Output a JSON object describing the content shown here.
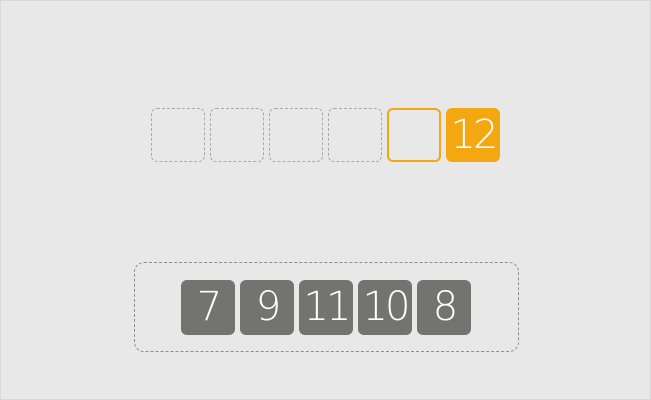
{
  "answer_row": {
    "slots": [
      {
        "state": "empty",
        "value": ""
      },
      {
        "state": "empty",
        "value": ""
      },
      {
        "state": "empty",
        "value": ""
      },
      {
        "state": "empty",
        "value": ""
      },
      {
        "state": "target",
        "value": ""
      },
      {
        "state": "filled",
        "value": "12"
      }
    ]
  },
  "tray": {
    "tiles": [
      "7",
      "9",
      "11",
      "10",
      "8"
    ]
  },
  "colors": {
    "accent": "#f5a712",
    "tile": "#737370",
    "background": "#e8e8e8"
  }
}
